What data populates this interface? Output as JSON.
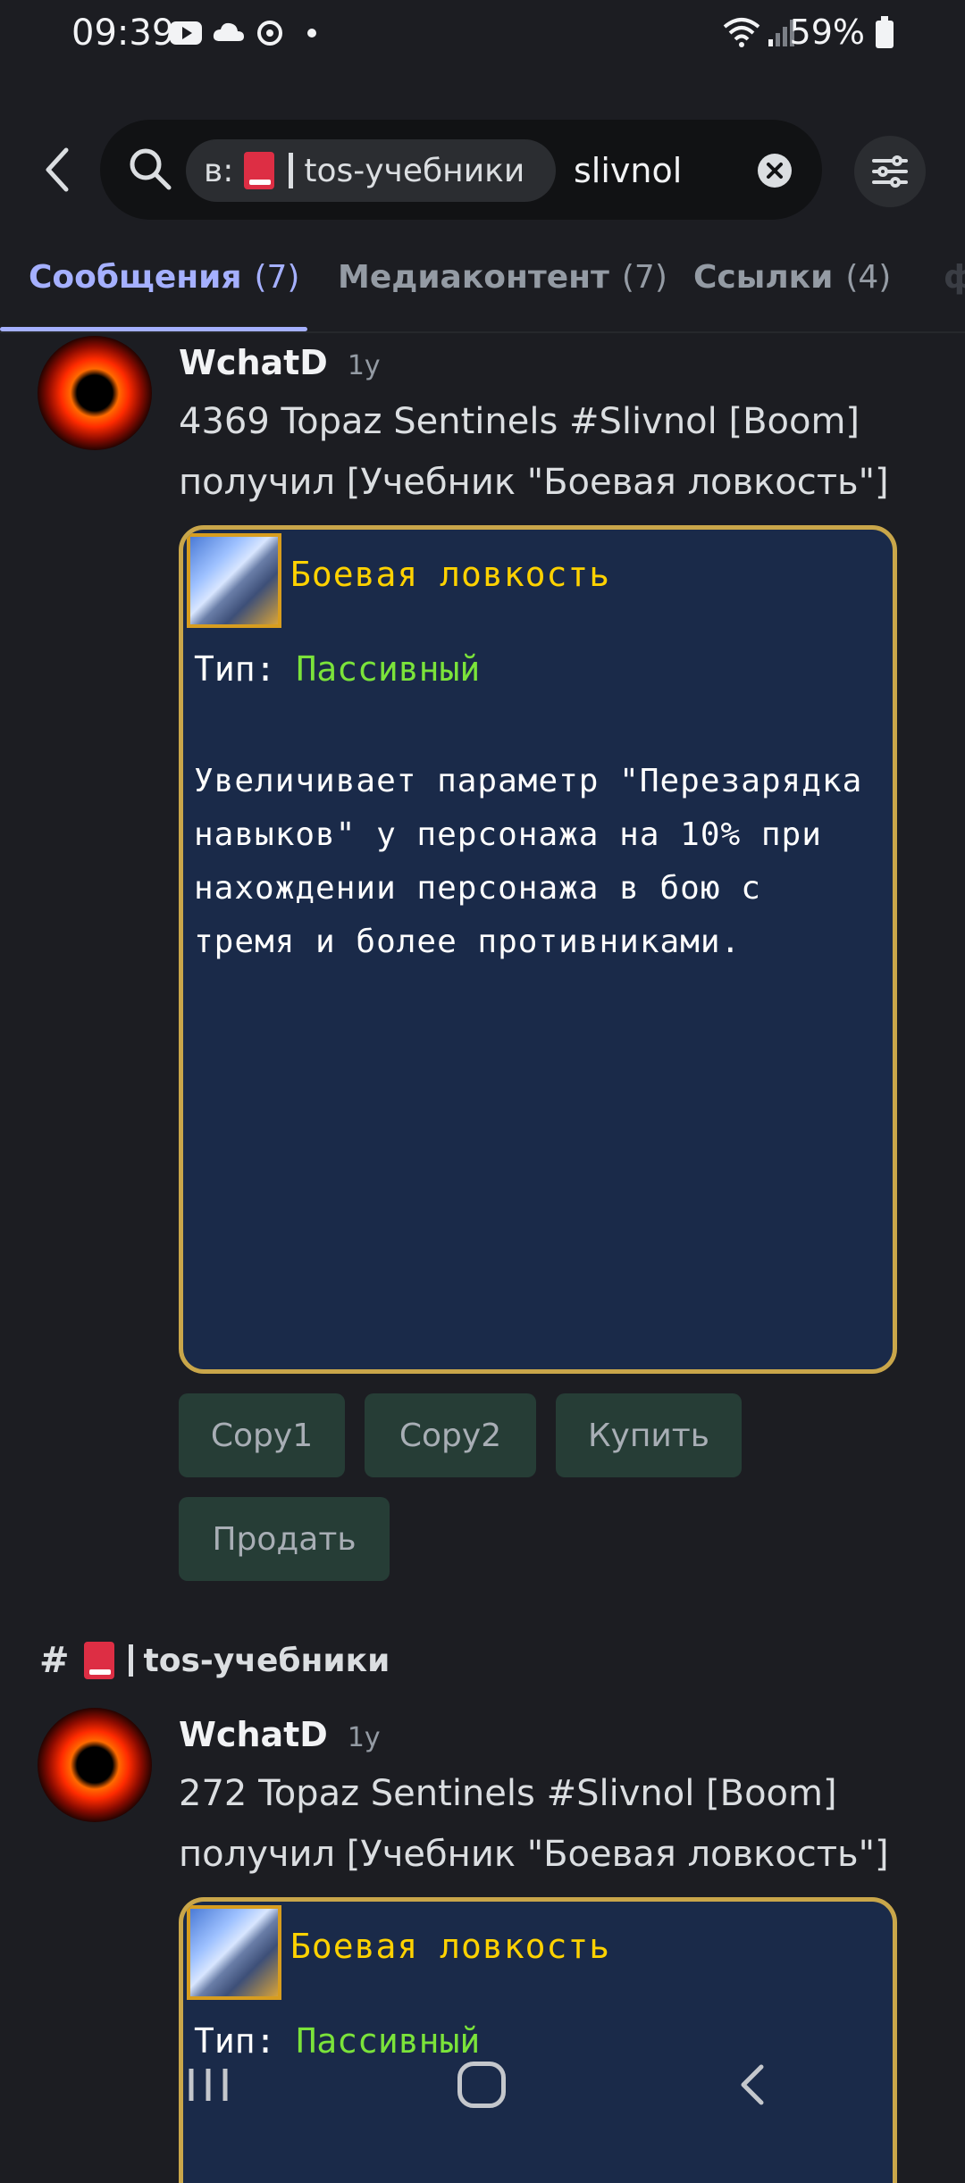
{
  "status_bar": {
    "time": "09:39",
    "battery": "59%"
  },
  "search": {
    "channel_prefix": "в:",
    "channel_name": "tos-учебники",
    "query": "slivnol"
  },
  "tabs": [
    {
      "label": "Сообщения",
      "count": "(7)"
    },
    {
      "label": "Медиаконтент",
      "count": "(7)"
    },
    {
      "label": "Ссылки",
      "count": "(4)"
    }
  ],
  "messages": [
    {
      "author": "WchatD",
      "time": "1y",
      "text": "4369 Topaz Sentinels #Slivnol [Boom] получил [Учебник \"Боевая ловкость\"]",
      "embed": {
        "title": "Боевая ловкость",
        "type_label": "Тип:",
        "type_value": "Пассивный",
        "description": "Увеличивает параметр \"Перезарядка навыков\" у персонажа на 10% при нахождении персонажа в бою с тремя и более противниками."
      },
      "buttons": [
        "Copy1",
        "Copy2",
        "Купить",
        "Продать"
      ]
    },
    {
      "channel": "tos-учебники",
      "author": "WchatD",
      "time": "1y",
      "text": "272 Topaz Sentinels #Slivnol [Boom] получил [Учебник \"Боевая ловкость\"]",
      "embed": {
        "title": "Боевая ловкость",
        "type_label": "Тип:",
        "type_value": "Пассивный"
      }
    }
  ],
  "colors": {
    "accent": "#a5b0ff",
    "embed_border": "#c9a64a",
    "button_bg": "#263d36",
    "background": "#1c1d22"
  }
}
